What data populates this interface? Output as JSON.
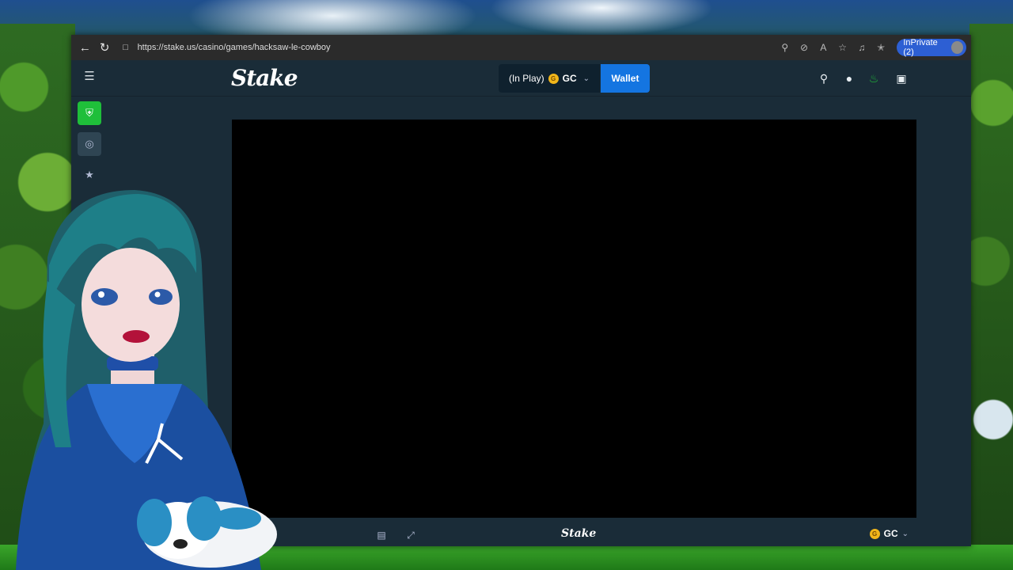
{
  "browser": {
    "url": "https://stake.us/casino/games/hacksaw-le-cowboy",
    "inprivate_label": "InPrivate (2)",
    "icons": [
      "zoom-icon",
      "tracking-off-icon",
      "read-aloud-icon",
      "favorite-star-icon",
      "collections-icon",
      "favorites-icon"
    ]
  },
  "header": {
    "logo": "Stake",
    "balance_status": "(In Play)",
    "coin_symbol": "G",
    "currency": "GC",
    "wallet_label": "Wallet"
  },
  "game_footer": {
    "logo": "Stake",
    "coin_symbol": "G",
    "currency": "GC"
  },
  "colors": {
    "bg": "#1a2c38",
    "wallet_blue": "#1475e1",
    "active_green": "#1fbf3a",
    "coin_gold": "#f1b61a"
  }
}
